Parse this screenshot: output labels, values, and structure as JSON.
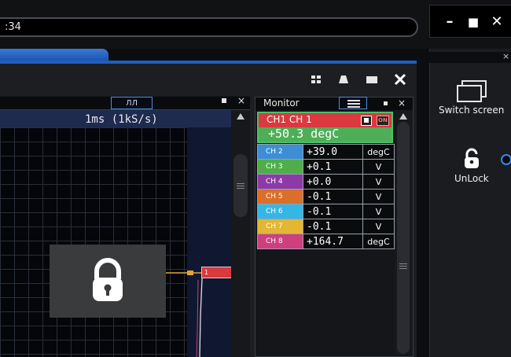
{
  "topbar": {
    "clock_text": ":34"
  },
  "window_controls": {
    "minimize": "–",
    "maximize": "■",
    "close": "✕"
  },
  "scope": {
    "timebase": "1ms (1kS/s)",
    "pulse_icon": "ЛЛ",
    "marker_label": "1",
    "marker_color": "#d9393f"
  },
  "monitor": {
    "title": "Monitor",
    "ch1": {
      "name": "CH1 CH 1",
      "on_label": "ON",
      "value": "+50.3 degC",
      "color": "#d9393f"
    },
    "channels": [
      {
        "label": "CH 2",
        "value": "+39.0",
        "unit": "degC",
        "color": "#3b8fd6"
      },
      {
        "label": "CH 3",
        "value": "+0.1",
        "unit": "V",
        "color": "#4fae4a"
      },
      {
        "label": "CH 4",
        "value": "+0.0",
        "unit": "V",
        "color": "#8b3aa8"
      },
      {
        "label": "CH 5",
        "value": "-0.1",
        "unit": "V",
        "color": "#d96f2a"
      },
      {
        "label": "CH 6",
        "value": "-0.1",
        "unit": "V",
        "color": "#35b7e6"
      },
      {
        "label": "CH 7",
        "value": "-0.1",
        "unit": "V",
        "color": "#e3b634"
      },
      {
        "label": "CH 8",
        "value": "+164.7",
        "unit": "degC",
        "color": "#cf3f7e"
      }
    ]
  },
  "side": {
    "switch_screen": "Switch screen",
    "unlock": "UnLock",
    "close": "×"
  },
  "accent": "#3a86e8"
}
